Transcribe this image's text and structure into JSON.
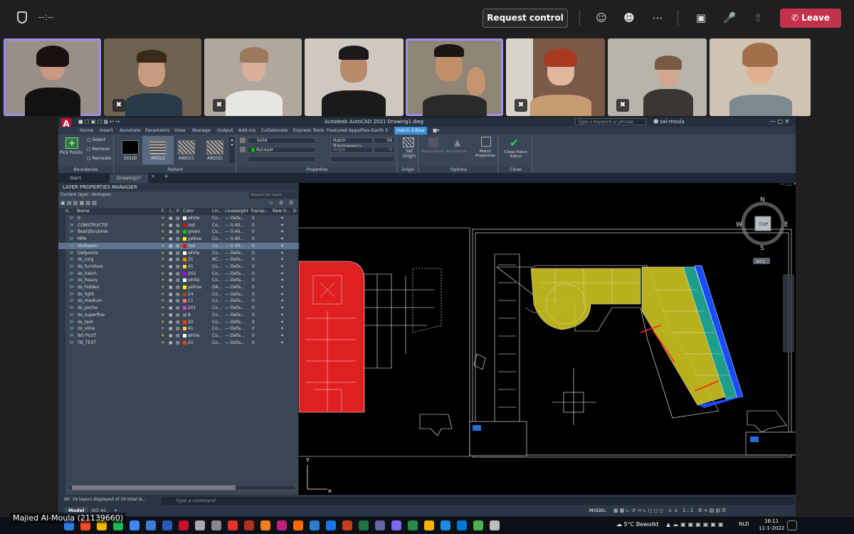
{
  "teams": {
    "timer": "--:--",
    "request_control": "Request control",
    "leave": "Leave",
    "presenter_name": "Majied Al-Moula (21139660)",
    "colors": {
      "leave": "#c4314b",
      "active_border": "#9b8fe8"
    }
  },
  "acad": {
    "title": "Autodesk AutoCAD 2021   Drawing1.dwg",
    "search_placeholder": "Type a keyword or phrase",
    "user": "sal-moula",
    "tabs": [
      "Home",
      "Insert",
      "Annotate",
      "Parametric",
      "View",
      "Manage",
      "Output",
      "Add-ins",
      "Collaborate",
      "Express Tools",
      "Featured Apps",
      "Plex-Earth 5",
      "Hatch Editor"
    ],
    "active_tab": "Hatch Editor",
    "ribbon": {
      "boundaries": {
        "title": "Boundaries",
        "pick_points": "Pick Points",
        "select": "Select",
        "remove": "Remove",
        "recreate": "Recreate"
      },
      "pattern": {
        "title": "Pattern",
        "items": [
          "SOLID",
          "ANGLE",
          "ANSI31",
          "ANSI32"
        ]
      },
      "properties": {
        "title": "Properties",
        "type": "Solid",
        "color": "ByLayer",
        "transparency_label": "Hatch Transparency",
        "transparency_value": "56",
        "angle_label": "Angle",
        "angle_value": "0"
      },
      "origin": {
        "title": "Origin",
        "set_origin": "Set Origin"
      },
      "options": {
        "title": "Options",
        "associative": "Associative",
        "annotative": "Annotative",
        "match_properties": "Match Properties"
      },
      "close": {
        "title": "Close",
        "close_editor": "Close Hatch Editor"
      }
    },
    "doc_tabs": [
      "Start",
      "Drawing1*"
    ],
    "layer_manager": {
      "title": "LAYER PROPERTIES MANAGER",
      "current_layer": "Current layer: Verkopen",
      "search_placeholder": "Search for layer",
      "columns": [
        "S..",
        "Name",
        "F..",
        "L..",
        "P..",
        "Color",
        "Lin...",
        "Lineweight",
        "Transp...",
        "New V...",
        "D"
      ],
      "layers": [
        {
          "name": "0",
          "color": "white",
          "swatch": "#ffffff",
          "lt": "Co...",
          "lw": "— Defa...",
          "tr": "0"
        },
        {
          "name": "CONSTRUCTIE",
          "color": "red",
          "swatch": "#ff0000",
          "lt": "Co...",
          "lw": "— 0.40...",
          "tr": "0"
        },
        {
          "name": "Bedrijfsruimte",
          "color": "green",
          "swatch": "#00cc00",
          "lt": "Co...",
          "lw": "— 0.40...",
          "tr": "0"
        },
        {
          "name": "MFA",
          "color": "yellow",
          "swatch": "#ffff00",
          "lt": "Co...",
          "lw": "— 0.40...",
          "tr": "0"
        },
        {
          "name": "Verkopen",
          "color": "red",
          "swatch": "#ff0000",
          "lt": "Co...",
          "lw": "— 0.40...",
          "tr": "0"
        },
        {
          "name": "Defpoints",
          "color": "white",
          "swatch": "#ffffff",
          "lt": "Co...",
          "lw": "— Defa...",
          "tr": "0"
        },
        {
          "name": "ds_colg",
          "color": "31",
          "swatch": "#ff8800",
          "lt": "AC...",
          "lw": "— Defa...",
          "tr": "0"
        },
        {
          "name": "ds_furniture",
          "color": "41",
          "swatch": "#ffcc44",
          "lt": "Co...",
          "lw": "— Defa...",
          "tr": "0"
        },
        {
          "name": "ds_hatch",
          "color": "202",
          "swatch": "#aa00ff",
          "lt": "Co...",
          "lw": "— Defa...",
          "tr": "0"
        },
        {
          "name": "ds_heavy",
          "color": "white",
          "swatch": "#ffffff",
          "lt": "Co...",
          "lw": "— Defa...",
          "tr": "0"
        },
        {
          "name": "ds_hidden",
          "color": "yellow",
          "swatch": "#ffff00",
          "lt": "DA...",
          "lw": "— Defa...",
          "tr": "0"
        },
        {
          "name": "ds_light",
          "color": "24",
          "swatch": "#aa4422",
          "lt": "Co...",
          "lw": "— Defa...",
          "tr": "0"
        },
        {
          "name": "ds_medium",
          "color": "11",
          "swatch": "#ff7777",
          "lt": "Co...",
          "lw": "— Defa...",
          "tr": "0"
        },
        {
          "name": "ds_poche",
          "color": "201",
          "swatch": "#cc44ff",
          "lt": "Co...",
          "lw": "— Defa...",
          "tr": "0"
        },
        {
          "name": "ds_superfine",
          "color": "8",
          "swatch": "#808080",
          "lt": "Co...",
          "lw": "— Defa...",
          "tr": "0"
        },
        {
          "name": "ds_text",
          "color": "20",
          "swatch": "#ff3f00",
          "lt": "Co...",
          "lw": "— Defa...",
          "tr": "0"
        },
        {
          "name": "ds_xline",
          "color": "41",
          "swatch": "#ffcc44",
          "lt": "Co...",
          "lw": "— Defa...",
          "tr": "0"
        },
        {
          "name": "NO PLOT",
          "color": "white",
          "swatch": "#ffffff",
          "lt": "Co...",
          "lw": "— Defa...",
          "tr": "0"
        },
        {
          "name": "TB_TEXT",
          "color": "20",
          "swatch": "#ff3f00",
          "lt": "Co...",
          "lw": "— Defa...",
          "tr": "0"
        }
      ],
      "selected_layer": "Verkopen",
      "footer": "All: 19 layers displayed of 19 total la..."
    },
    "viewcube": {
      "n": "N",
      "s": "S",
      "e": "E",
      "w": "W",
      "top": "TOP",
      "wcs": "WCS"
    },
    "ucs_y": "Y",
    "command_placeholder": "Type a command",
    "layout_tabs": [
      "Model",
      "ISO A1"
    ],
    "status_model": "MODEL",
    "hatch_colors": {
      "red": "#e02020",
      "yellow": "#c8c020",
      "teal": "#1e9e8a",
      "blue": "#1a4cff"
    }
  },
  "taskbar": {
    "weather": "5°C  Bewolkt",
    "lang": "NLD",
    "time": "16:11",
    "date": "11-1-2022"
  }
}
